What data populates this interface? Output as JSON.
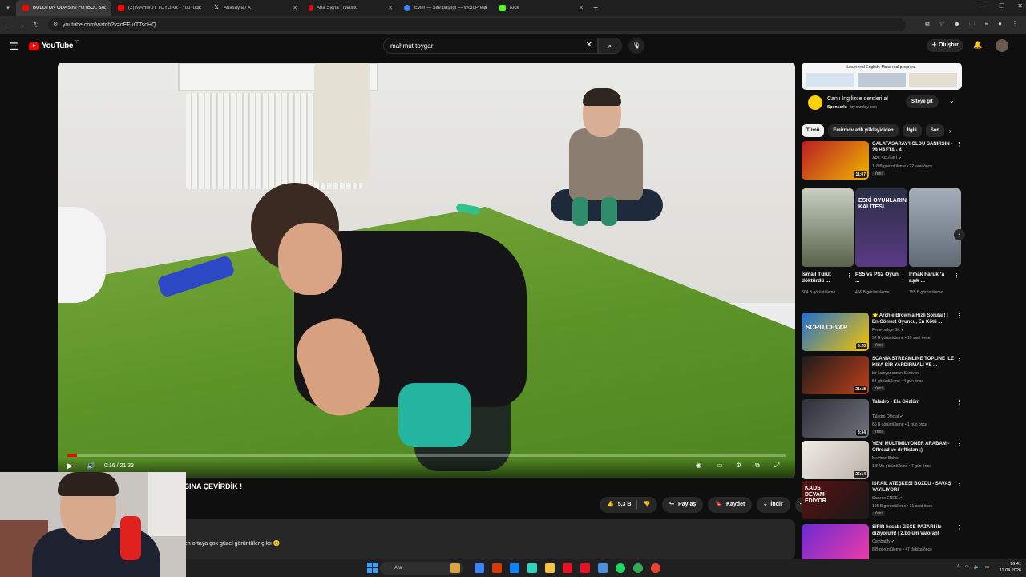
{
  "browser": {
    "tabs": [
      {
        "label": "BULUTUN ODASINI FUTBOL SAH",
        "favicon_color": "#ff0000",
        "active": true
      },
      {
        "label": "(2) MAHMUT TOYGAR - YouTube",
        "favicon_color": "#ff0000",
        "active": false
      },
      {
        "label": "Anasayfa / X",
        "favicon_color": "#ffffff",
        "active": false
      },
      {
        "label": "Ana Sayfa - Netflix",
        "favicon_color": "#e50914",
        "active": false
      },
      {
        "label": "Evim — Site başlığı — WordPress",
        "favicon_color": "#3b82f6",
        "active": false
      },
      {
        "label": "Kick",
        "favicon_color": "#53fc18",
        "active": false
      }
    ],
    "url": "youtube.com/watch?v=oEFurTTsoHQ"
  },
  "youtube": {
    "logo_text": "YouTube",
    "country_code": "TR",
    "search_value": "mahmut toygar",
    "create_label": "Oluştur"
  },
  "player": {
    "time_display": "0:16 / 21:33",
    "progress_fraction": 0.013
  },
  "video": {
    "title_fragment": "SINA ÇEVİRDİK !",
    "likes": "5,3 B",
    "share_label": "Paylaş",
    "save_label": "Kaydet",
    "download_label": "İndir",
    "description_snippet": "en ortaya çok güzel görüntüler çıktı 😊"
  },
  "ad": {
    "banner_text": "Learn real English. Make real progress.",
    "title": "Canlı İngilizce dersleri al",
    "sponsor_label": "Sponsorlu",
    "sponsor_domain": "try.cambly.com",
    "button_label": "Siteye git"
  },
  "chips": [
    "Tümü",
    "Emirriviv adlı yükleyiciden",
    "İlgili",
    "Son"
  ],
  "recommendations_top": [
    {
      "title": "GALATASARAY'I ÖLDÜ SANIRSIN - 29.HAFTA - 4 ...",
      "channel": "ARF SEVİMLİ",
      "meta": "118 B görüntüleme • 22 saat önce",
      "badge": "Yeni",
      "duration": "11:07",
      "thumb_color": "#c1272d"
    }
  ],
  "shorts": [
    {
      "title": "İsmail Türüt döktürdü ...",
      "views": "304 B görüntüleme",
      "thumb_color": "#7a8a5a"
    },
    {
      "title": "PS5 vs PS2 Oyun ...",
      "views": "466 B görüntüleme",
      "thumb_color": "#3a4d8a"
    },
    {
      "title": "Irmak Faruk ‘a aşık ...",
      "views": "755 B görüntüleme",
      "thumb_color": "#7b8591"
    }
  ],
  "shorts_overlay": {
    "line1": "ESKİ OYUNLARIN",
    "line2": "KALİTESİ"
  },
  "recommendations": [
    {
      "title": "🌟 Archie Brown'a Hızlı Sorular! | En Cömert Oyuncu, En Kötü ...",
      "channel": "Fenerbahçe SK",
      "meta": "32 B görüntüleme • 19 saat önce",
      "badge": "Yeni",
      "duration": "5:20",
      "thumb_color": "#1f6fd1",
      "thumb_text": "SORU CEVAP"
    },
    {
      "title": "SCANIA STREAMLİNE TOPLİNE İLE KISA BİR YARDIRMALI VE ...",
      "channel": "bir kamyoncunun Serüveni",
      "meta": "53 görüntüleme • 4 gün önce",
      "badge": "Yeni",
      "duration": "21:18",
      "thumb_color": "#b83a1c",
      "thumb_text": ""
    },
    {
      "title": "Taladro - Ela Gözlüm",
      "channel": "Taladro Official",
      "meta": "66 B görüntüleme • 1 gün önce",
      "badge": "Yeni",
      "duration": "3:34",
      "thumb_color": "#4a4d55",
      "thumb_text": ""
    },
    {
      "title": "YENİ MULTİMİLYONER ARABAM - Offroad ve driftistan ;)",
      "channel": "Mevlcan Bahav",
      "meta": "1,8 Mn görüntüleme • 7 gün önce",
      "badge": "",
      "duration": "26:14",
      "thumb_color": "#d8d4cf",
      "thumb_text": ""
    },
    {
      "title": "İSRAİL ATEŞKESİ BOZDU - SAVAŞ YAYILIYOR!",
      "channel": "Sadece ENES",
      "meta": "195 B görüntüleme • 21 saat önce",
      "badge": "Yeni",
      "duration": "",
      "thumb_color": "#8a1c1c",
      "thumb_text": "KADS DEVAM EDİYOR"
    },
    {
      "title": "SIFIR hesabı GECE PAZARI ile diziyorum! | 2.bölüm Valorant",
      "channel": "Combatify",
      "meta": "8 B görüntüleme • 47 dakika önce",
      "badge": "",
      "duration": "",
      "thumb_color": "#6a2bd1",
      "thumb_text": ""
    }
  ],
  "taskbar": {
    "search_placeholder": "Ara",
    "time": "16:41",
    "date": "11.04.2026",
    "icon_colors": [
      "#d9a441",
      "#3b82f6",
      "#d83b01",
      "#0a84ff",
      "#2dd4bf",
      "#f6c343",
      "#e81123",
      "#e81123",
      "#4a90e2",
      "#1ed760",
      "#34a853",
      "#ea4335"
    ]
  }
}
